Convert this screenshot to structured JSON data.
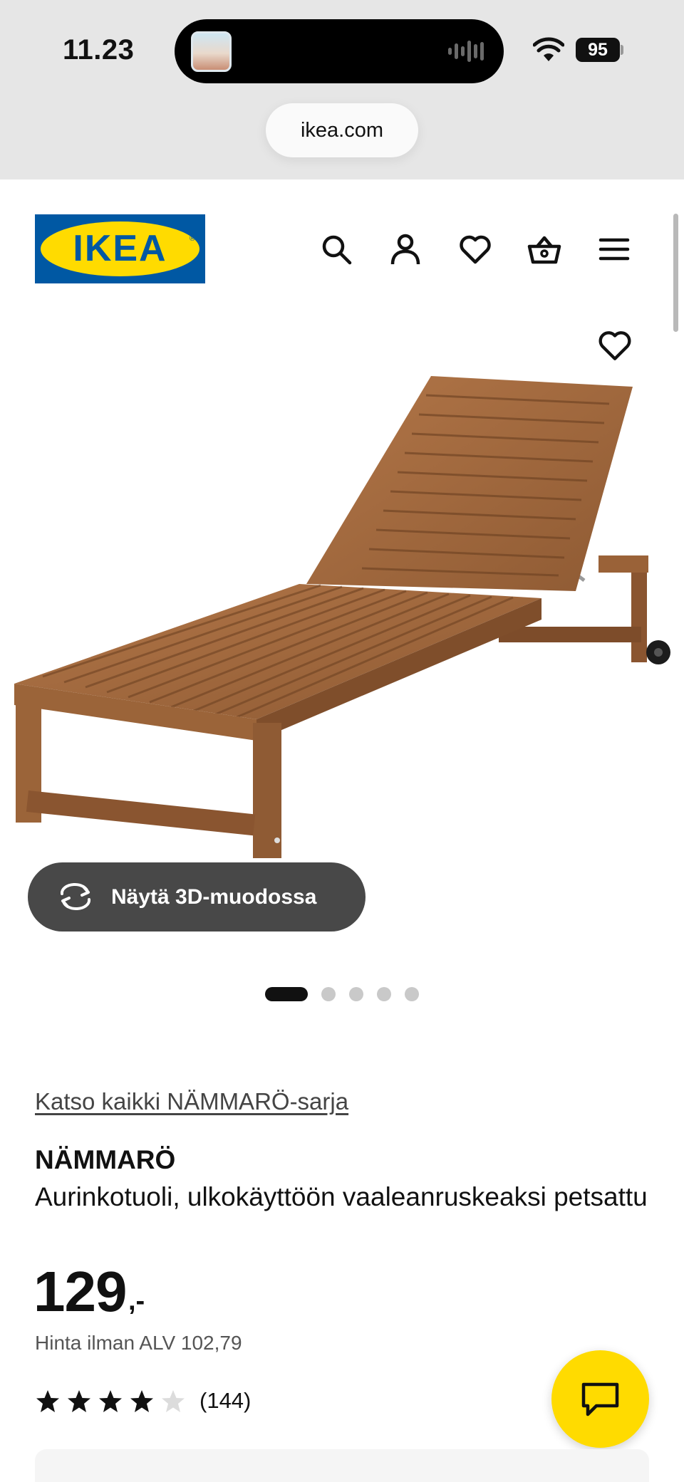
{
  "status_bar": {
    "time": "11.23",
    "battery": "95",
    "url": "ikea.com"
  },
  "header": {
    "logo_text": "IKEA",
    "icons": [
      "search-icon",
      "account-icon",
      "heart-icon",
      "basket-icon",
      "menu-icon"
    ]
  },
  "gallery": {
    "view_3d_label": "Näytä 3D-muodossa",
    "image_count": 5,
    "active_index": 0
  },
  "product": {
    "series_link": "Katso kaikki NÄMMARÖ-sarja",
    "name": "NÄMMARÖ",
    "description": "Aurinkotuoli, ulkokäyttöön vaaleanruskeaksi petsattu",
    "price": "129",
    "price_suffix": ",-",
    "price_excl_vat": "Hinta ilman ALV 102,79",
    "rating": 4.5,
    "review_count": "(144)"
  },
  "colors": {
    "ikea_blue": "#0058a3",
    "ikea_yellow": "#ffdb00",
    "button_dark": "#484848"
  }
}
